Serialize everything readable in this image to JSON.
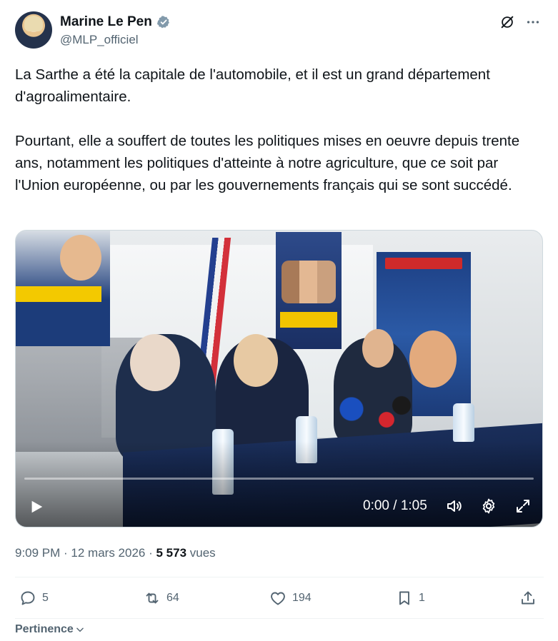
{
  "author": {
    "display_name": "Marine Le Pen",
    "handle": "@MLP_officiel",
    "verified": true,
    "verified_color": "#829aab"
  },
  "top_icons": [
    "grok-icon",
    "more-icon"
  ],
  "tweet": {
    "text": "La Sarthe a été la capitale de l'automobile, et il est un grand département d'agroalimentaire.\n\nPourtant, elle a souffert de toutes les politiques mises en oeuvre depuis trente ans, notamment les politiques d'atteinte à notre agriculture, que ce soit par l'Union européenne, ou par les gouvernements français qui se sont succédé."
  },
  "video": {
    "current_time": "0:00",
    "duration": "1:05",
    "time_display": "0:00 / 1:05",
    "progress": 0
  },
  "meta": {
    "time": "9:09 PM",
    "separator": " · ",
    "date": "12 mars 2026",
    "views_count": "5 573",
    "views_label": " vues"
  },
  "actions": {
    "replies": "5",
    "retweets": "64",
    "likes": "194",
    "bookmarks": "1"
  },
  "sort": {
    "label": "Pertinence"
  },
  "colors": {
    "text_primary": "#0f1419",
    "text_secondary": "#536471",
    "divider": "#eff3f4"
  }
}
